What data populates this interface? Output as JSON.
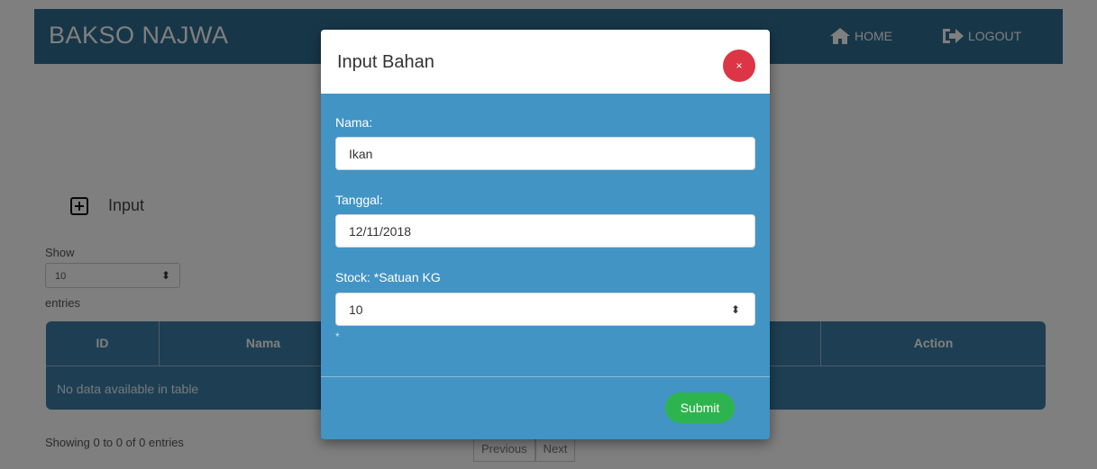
{
  "navbar": {
    "brand": "BAKSO NAJWA",
    "home_label": "HOME",
    "logout_label": "LOGOUT"
  },
  "main": {
    "input_label": "Input",
    "show_label": "Show",
    "length_value": "10",
    "entries_label": "entries",
    "table": {
      "headers": {
        "id": "ID",
        "nama": "Nama",
        "action": "Action"
      },
      "empty_message": "No data available in table"
    },
    "info": "Showing 0 to 0 of 0 entries",
    "pagination": {
      "previous": "Previous",
      "next": "Next"
    }
  },
  "modal": {
    "title": "Input Bahan",
    "close_label": "×",
    "fields": {
      "nama_label": "Nama:",
      "nama_value": "Ikan",
      "tanggal_label": "Tanggal:",
      "tanggal_value": "12/11/2018",
      "stock_label": "Stock: *Satuan KG",
      "stock_value": "10",
      "note": "*"
    },
    "submit_label": "Submit"
  },
  "colors": {
    "navbar": "#2f6e92",
    "modal_body": "#4294c4",
    "close": "#dc3545",
    "submit": "#2eb44e"
  },
  "icons": {
    "home": "home-icon",
    "logout": "logout-icon",
    "plus": "plus-square-icon"
  }
}
